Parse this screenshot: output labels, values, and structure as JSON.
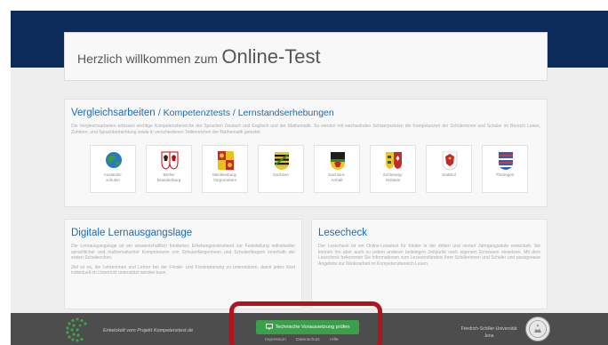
{
  "header": {
    "prefix": "Herzlich willkommen zum",
    "title": "Online-Test"
  },
  "vergleichsarbeiten": {
    "title": "Vergleichsarbeiten",
    "subtitle": "/ Kompetenztests / Lernstandserhebungen",
    "text": "Die Vergleichsarbeiten erfassen wichtige Kompetenzbereiche der Sprachen Deutsch und Englisch und der Mathematik. So werden mit wechselnden Schwerpunkten die Kompetenzen der Schülerinnen und Schüler im Bereich Lesen, Zuhören, und Sprachbetrachtung sowie in verschiedenen Teilbereichen der Mathematik getestet.",
    "states": [
      {
        "name": "Auslands-\nschulen",
        "icon": "globe-icon"
      },
      {
        "name": "Berlin/\nBrandenburg",
        "icon": "berlin-brandenburg-coat-icon"
      },
      {
        "name": "Mecklenburg-\nVorpommern",
        "icon": "mecklenburg-coat-icon"
      },
      {
        "name": "Sachsen",
        "icon": "sachsen-coat-icon"
      },
      {
        "name": "Sachsen-\nAnhalt",
        "icon": "sachsen-anhalt-coat-icon"
      },
      {
        "name": "Schleswig-\nHolstein",
        "icon": "schleswig-holstein-coat-icon"
      },
      {
        "name": "Südtirol",
        "icon": "suedtirol-coat-icon"
      },
      {
        "name": "Thüringen",
        "icon": "thueringen-coat-icon"
      }
    ]
  },
  "lernausgangslage": {
    "title": "Digitale Lernausgangslage",
    "text1": "Die Lernausgangslage ist ein wissenschaftlich fundiertes Erhebungsinstrument zur Feststellung individueller sprachlicher und mathematischer Kompetenzen von Schulanfängerinnen und Schulanfängern innerhalb der ersten Schulwochen.",
    "text2": "Ziel ist es, die Lehrerinnen und Lehrer bei der Förder- und Förderplanung zu unterstützen, damit jedes Kind individuell im Unterricht unterstützt werden kann."
  },
  "lesecheck": {
    "title": "Lesecheck",
    "text": "Der Lesecheck ist ein Online-Leisetest für Kinder in der dritten und vierten Jahrgangsstufe entwickelt. Sie können ihn aber auch zu jedem anderen beliebigen Zeitpunkt nach eigenem Ermessen einsetzen. Mit dem Lesecheck bekommen Sie Informationen zum Leseverständnis Ihrer Schülerinnen und Schüler und passgenaue Angebote zur Weiterarbeit im Kompetenzbereich Lesen."
  },
  "footer": {
    "developed": "Entwickelt vom Projekt Kompetenztest.de",
    "button": "Technische Voraussetzung prüfen",
    "links": [
      "Impressum",
      "Datenschutz",
      "Hilfe"
    ],
    "university": "Friedrich-Schiller-Universität",
    "university_place": "Jena"
  },
  "colors": {
    "navy": "#0c2a5a",
    "link_blue": "#1b6ab8",
    "button_green": "#3aa04a",
    "highlight_red": "#b0141f",
    "footer_gray": "#4d4d4d"
  }
}
